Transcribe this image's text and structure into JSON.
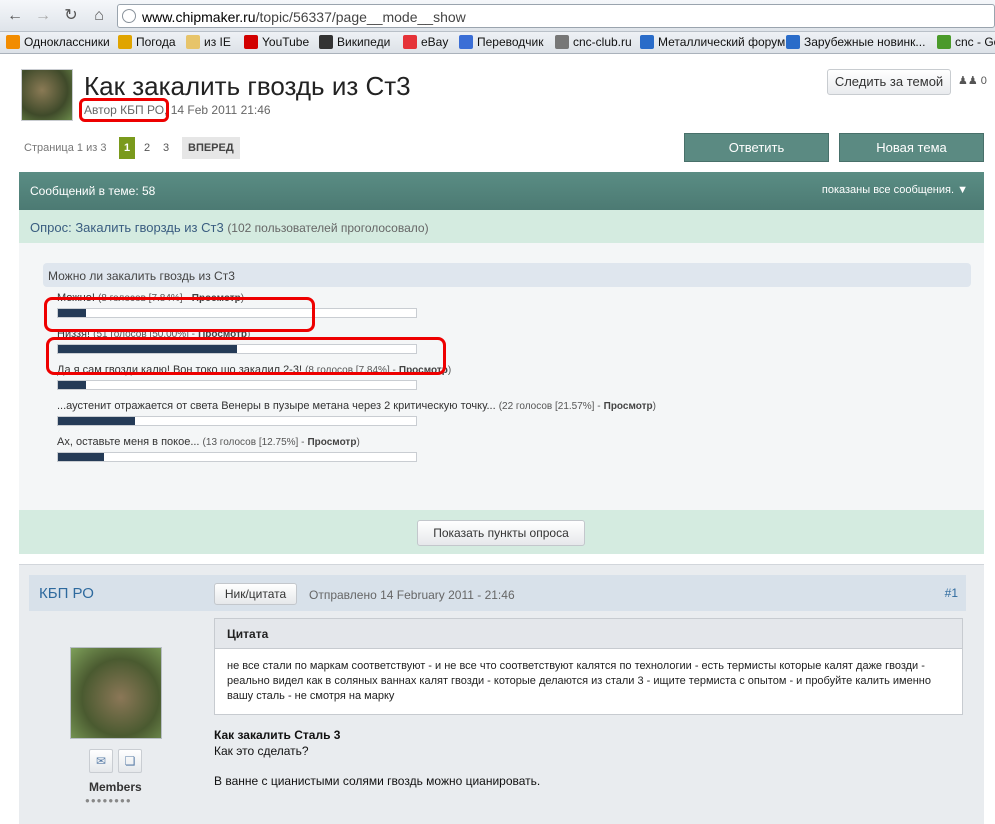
{
  "browser": {
    "url_domain": "www.chipmaker.ru",
    "url_path": "/topic/56337/page__mode__show",
    "bookmarks": [
      {
        "label": "Одноклассники",
        "icon": "odnoklassniki-icon",
        "color": "#f28c00"
      },
      {
        "label": "Погода",
        "icon": "weather-icon",
        "color": "#e0a400"
      },
      {
        "label": "из IE",
        "icon": "folder-icon",
        "color": "#e7c46a"
      },
      {
        "label": "YouTube",
        "icon": "youtube-icon",
        "color": "#d20000"
      },
      {
        "label": "Википеди",
        "icon": "wikipedia-icon",
        "color": "#333333"
      },
      {
        "label": "eBay",
        "icon": "ebay-icon",
        "color": "#e53238"
      },
      {
        "label": "Переводчик",
        "icon": "translate-icon",
        "color": "#3b6ed6"
      },
      {
        "label": "cnc-club.ru",
        "icon": "cnc-club-icon",
        "color": "#777777"
      },
      {
        "label": "Металлический форум",
        "icon": "metal-forum-icon",
        "color": "#2a6cc9"
      },
      {
        "label": "Зарубежные новинк...",
        "icon": "news-icon",
        "color": "#2a6cc9"
      },
      {
        "label": "cnc - Go",
        "icon": "cnc-go-icon",
        "color": "#4a9a2a"
      }
    ]
  },
  "topic": {
    "title": "Как закалить гвоздь из Ст3",
    "author_label": "Автор КБП РО,",
    "date": "14 Feb 2011 21:46",
    "follow": "Следить за темой",
    "followers": "0"
  },
  "pager": {
    "label": "Страница 1 из 3",
    "pages": [
      "1",
      "2",
      "3"
    ],
    "next": "ВПЕРЕД"
  },
  "actions": {
    "reply": "Ответить",
    "new_topic": "Новая тема"
  },
  "poll": {
    "count_label": "Сообщений в теме: 58",
    "filter": "показаны все сообщения.",
    "title": "Опрос: Закалить гворздь из Ст3",
    "voters": "(102 пользователей проголосовало)",
    "question": "Можно ли закалить гвоздь из Ст3",
    "view_label": "Просмотр",
    "options": [
      {
        "label": "Можно!",
        "votes": "(8 голосов [7.84%] -",
        "pct": 7.84
      },
      {
        "label": "Низзя!",
        "votes": "(51 голосов [50.00%] -",
        "pct": 50.0
      },
      {
        "label": "Да я сам гвозди калю! Вон токо шо закалил 2-3!",
        "votes": "(8 голосов [7.84%] -",
        "pct": 7.84
      },
      {
        "label": "...аустенит отражается от света Венеры в пузыре метана через 2 критическую точку...",
        "votes": "(22 голосов [21.57%] -",
        "pct": 21.57
      },
      {
        "label": "Ах, оставьте меня в покое...",
        "votes": "(13 голосов [12.75%] -",
        "pct": 12.75
      }
    ],
    "show_options": "Показать пункты опроса"
  },
  "post": {
    "author": "КБП РО",
    "quote_btn": "Ник/цитата",
    "sent": "Отправлено 14 February 2011 - 21:46",
    "number": "#1",
    "group": "Members",
    "quote_title": "Цитата",
    "quote_text": "не все стали по маркам соответствуют - и не все что соответствуют калятся по технологии - есть термисты которые калят даже гвозди - реально видел как в соляных ваннах калят гвозди - которые делаются из стали 3 - ищите термиста с опытом - и пробуйте калить именно вашу сталь - не смотря на марку",
    "heading": "Как закалить Сталь 3",
    "line1": "Как это сделать?",
    "line2": "В ванне с цианистыми солями гвоздь можно цианировать."
  }
}
